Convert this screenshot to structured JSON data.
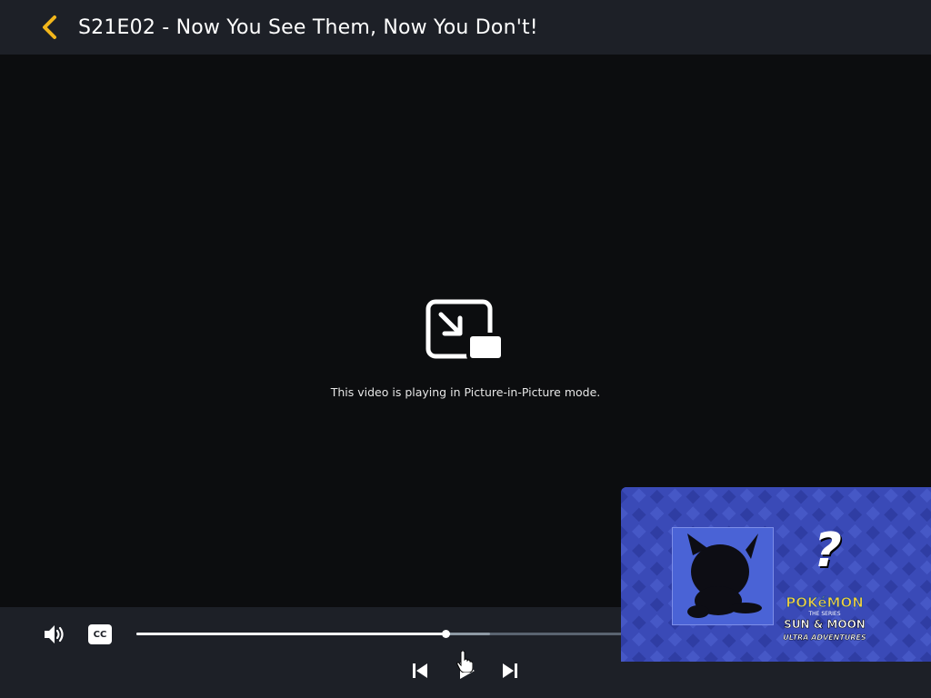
{
  "header": {
    "title": "S21E02 - Now You See Them, Now You Don't!"
  },
  "video": {
    "pip_message": "This video is playing in Picture-in-Picture mode."
  },
  "controls": {
    "cc_label": "CC",
    "progress": 0.63,
    "buffered": 0.72
  },
  "pip_window": {
    "question_mark": "?",
    "logo_lines": [
      "POKéMON",
      "THE SERIES",
      "SUN & MOON",
      "ULTRA ADVENTURES"
    ]
  },
  "colors": {
    "header_bg": "#1d2027",
    "accent": "#f2b61b",
    "video_bg": "#0c0d0f",
    "pip_blue": "#3a4ab7"
  }
}
